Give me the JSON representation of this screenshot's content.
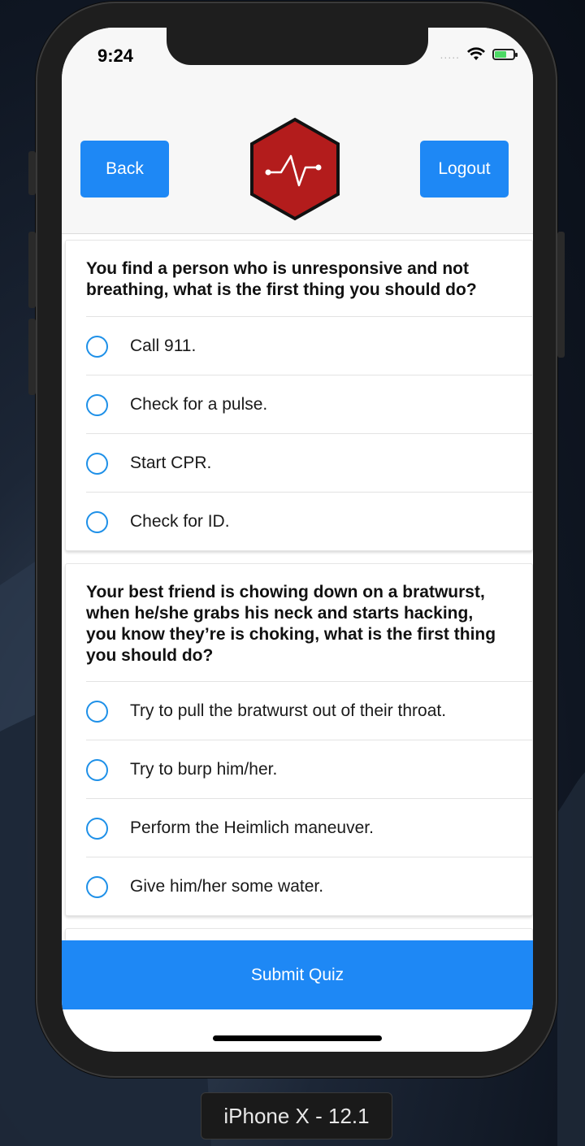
{
  "status_bar": {
    "time": "9:24",
    "signal": ".....",
    "wifi_icon": "wifi-icon",
    "battery_icon": "battery-charging-icon"
  },
  "header": {
    "back_label": "Back",
    "logout_label": "Logout",
    "logo_icon": "heartbeat-hexagon-icon"
  },
  "colors": {
    "accent": "#1e88f5",
    "logo_red": "#b71c1c",
    "radio_blue": "#1e90e8"
  },
  "questions": [
    {
      "text": "You find a person who is unresponsive and not breathing, what is the first thing you should do?",
      "options": [
        "Call 911.",
        "Check for a pulse.",
        "Start CPR.",
        "Check for ID."
      ]
    },
    {
      "text": "Your best friend is chowing down on a bratwurst, when he/she grabs his neck and starts hacking, you know they’re is choking, what is the first thing you should do?",
      "options": [
        "Try to pull the bratwurst out of their throat.",
        "Try to burp him/her.",
        "Perform the Heimlich maneuver.",
        "Give him/her some water."
      ]
    }
  ],
  "footer": {
    "submit_label": "Submit Quiz"
  },
  "simulator": {
    "device_label": "iPhone X - 12.1"
  }
}
